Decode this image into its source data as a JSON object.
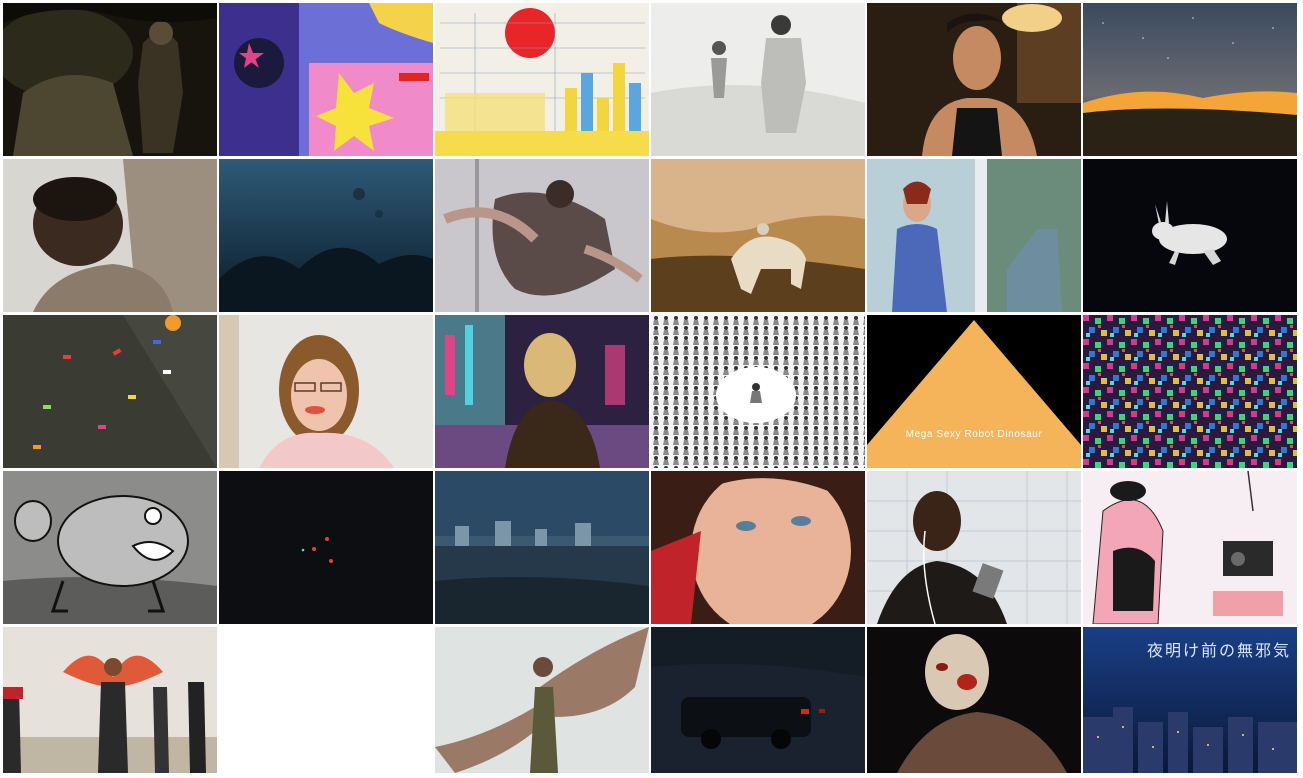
{
  "collage": {
    "rows": 5,
    "columns": 6,
    "tiles": [
      {
        "r": 1,
        "c": 1,
        "subject": "dark forest scene with rider on horse"
      },
      {
        "r": 1,
        "c": 2,
        "subject": "colorful illustrated figures, purple and yellow"
      },
      {
        "r": 1,
        "c": 3,
        "subject": "infographic with red sun and bar chart"
      },
      {
        "r": 1,
        "c": 4,
        "subject": "two figures in white overexposed landscape"
      },
      {
        "r": 1,
        "c": 5,
        "subject": "young man in black tank top"
      },
      {
        "r": 1,
        "c": 6,
        "subject": "starry night sky over glowing city lights"
      },
      {
        "r": 2,
        "c": 1,
        "subject": "man looking down in pale room"
      },
      {
        "r": 2,
        "c": 2,
        "subject": "dark blue underwater scene"
      },
      {
        "r": 2,
        "c": 3,
        "subject": "dancers embracing near pole"
      },
      {
        "r": 2,
        "c": 4,
        "subject": "painted horses and rider in golden landscape"
      },
      {
        "r": 2,
        "c": 5,
        "subject": "woman in blue scrubs by window"
      },
      {
        "r": 2,
        "c": 6,
        "subject": "white rabbit on black background"
      },
      {
        "r": 3,
        "c": 1,
        "subject": "climbing wall with colored holds"
      },
      {
        "r": 3,
        "c": 2,
        "subject": "woman with glasses in pink top"
      },
      {
        "r": 3,
        "c": 3,
        "subject": "blonde woman on neon-lit street"
      },
      {
        "r": 3,
        "c": 4,
        "subject": "crowd of drawn figures around a circle"
      },
      {
        "r": 3,
        "c": 5,
        "subject": "orange triangle title card on black",
        "caption": "Mega Sexy Robot Dinosaur"
      },
      {
        "r": 3,
        "c": 6,
        "subject": "multicolor noise texture"
      },
      {
        "r": 4,
        "c": 1,
        "subject": "cartoon monster in grayscale landscape"
      },
      {
        "r": 4,
        "c": 2,
        "subject": "black frame with small red lights"
      },
      {
        "r": 4,
        "c": 3,
        "subject": "blue dusk field with distant industry"
      },
      {
        "r": 4,
        "c": 4,
        "subject": "close-up of freckled boy"
      },
      {
        "r": 4,
        "c": 5,
        "subject": "man with earphones against tiled wall"
      },
      {
        "r": 4,
        "c": 6,
        "subject": "pink illustration of bather with radio"
      },
      {
        "r": 5,
        "c": 1,
        "subject": "woman with red wings, street performers"
      },
      {
        "r": 5,
        "c": 2,
        "subject": "empty white"
      },
      {
        "r": 5,
        "c": 3,
        "subject": "winged figure against pale sky"
      },
      {
        "r": 5,
        "c": 4,
        "subject": "car at night with red tail lights"
      },
      {
        "r": 5,
        "c": 5,
        "subject": "bald figure with wounds, dark"
      },
      {
        "r": 5,
        "c": 6,
        "subject": "blue night cityscape",
        "caption": "夜明け前の無邪気"
      }
    ]
  },
  "palette": {
    "white": "#ffffff",
    "black": "#000000",
    "orange": "#f5b35a",
    "night_blue": "#1a3f86"
  }
}
